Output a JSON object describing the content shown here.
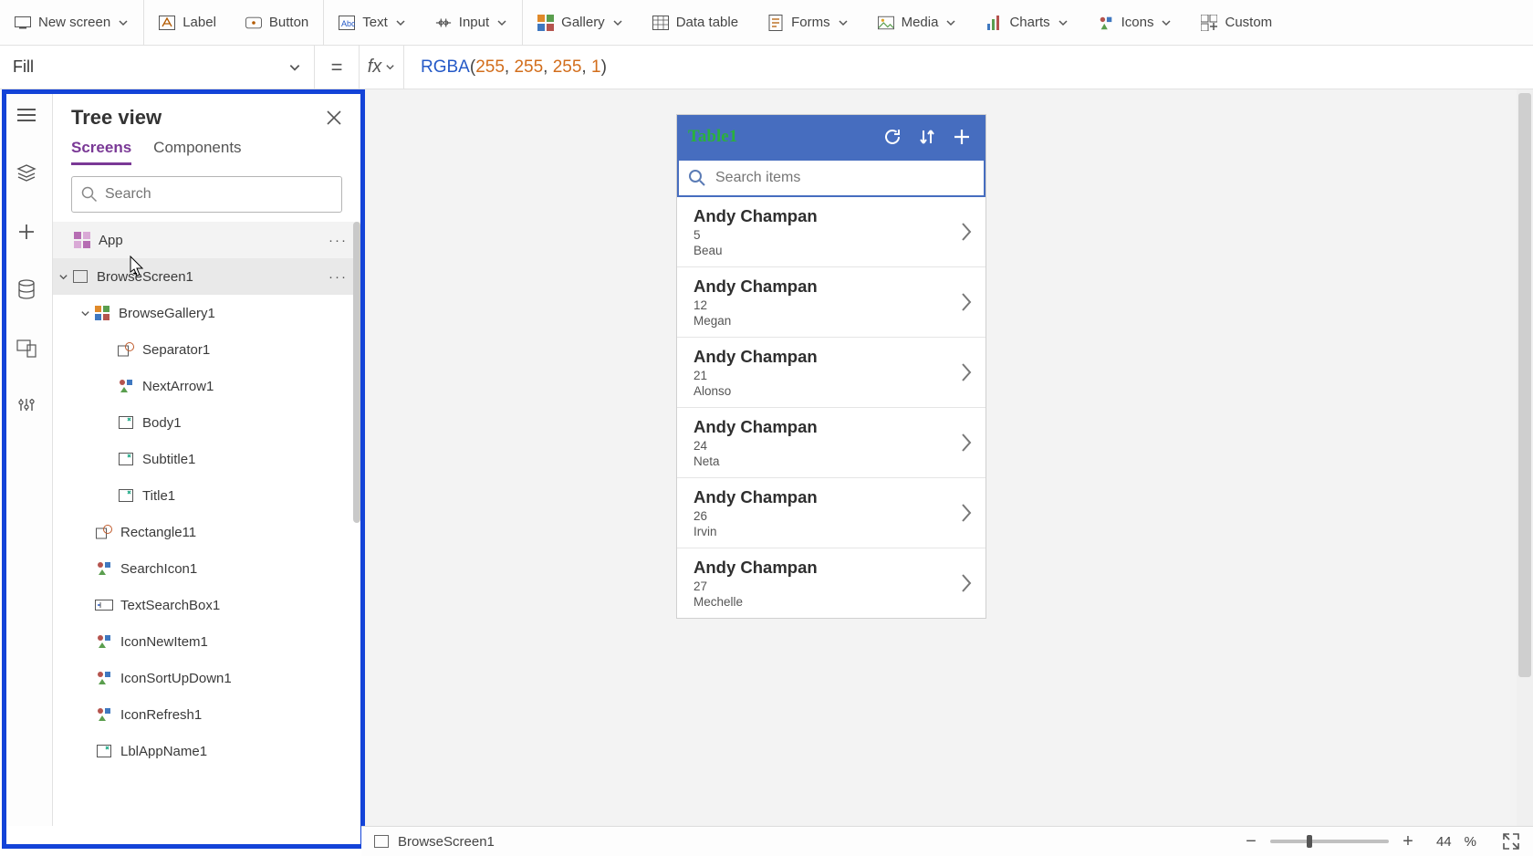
{
  "ribbon": {
    "new_screen": "New screen",
    "label": "Label",
    "button": "Button",
    "text": "Text",
    "input": "Input",
    "gallery": "Gallery",
    "data_table": "Data table",
    "forms": "Forms",
    "media": "Media",
    "charts": "Charts",
    "icons": "Icons",
    "custom": "Custom"
  },
  "property_bar": {
    "property": "Fill",
    "equals": "="
  },
  "formula": {
    "fn": "RGBA",
    "args": [
      "255",
      "255",
      "255",
      "1"
    ]
  },
  "tree": {
    "title": "Tree view",
    "tab_screens": "Screens",
    "tab_components": "Components",
    "search_placeholder": "Search",
    "app": "App",
    "nodes": {
      "browseScreen": "BrowseScreen1",
      "browseGallery": "BrowseGallery1",
      "separator": "Separator1",
      "nextArrow": "NextArrow1",
      "body": "Body1",
      "subtitle": "Subtitle1",
      "title": "Title1",
      "rectangle": "Rectangle11",
      "searchIcon": "SearchIcon1",
      "textSearchBox": "TextSearchBox1",
      "iconNewItem": "IconNewItem1",
      "iconSortUpDown": "IconSortUpDown1",
      "iconRefresh": "IconRefresh1",
      "lblAppName": "LblAppName1"
    }
  },
  "phone": {
    "title": "Table1",
    "search_placeholder": "Search items",
    "items": [
      {
        "title": "Andy Champan",
        "sub1": "5",
        "sub2": "Beau"
      },
      {
        "title": "Andy Champan",
        "sub1": "12",
        "sub2": "Megan"
      },
      {
        "title": "Andy Champan",
        "sub1": "21",
        "sub2": "Alonso"
      },
      {
        "title": "Andy Champan",
        "sub1": "24",
        "sub2": "Neta"
      },
      {
        "title": "Andy Champan",
        "sub1": "26",
        "sub2": "Irvin"
      },
      {
        "title": "Andy Champan",
        "sub1": "27",
        "sub2": "Mechelle"
      }
    ]
  },
  "status": {
    "selection": "BrowseScreen1",
    "zoom_value": "44",
    "zoom_pct": "%"
  }
}
